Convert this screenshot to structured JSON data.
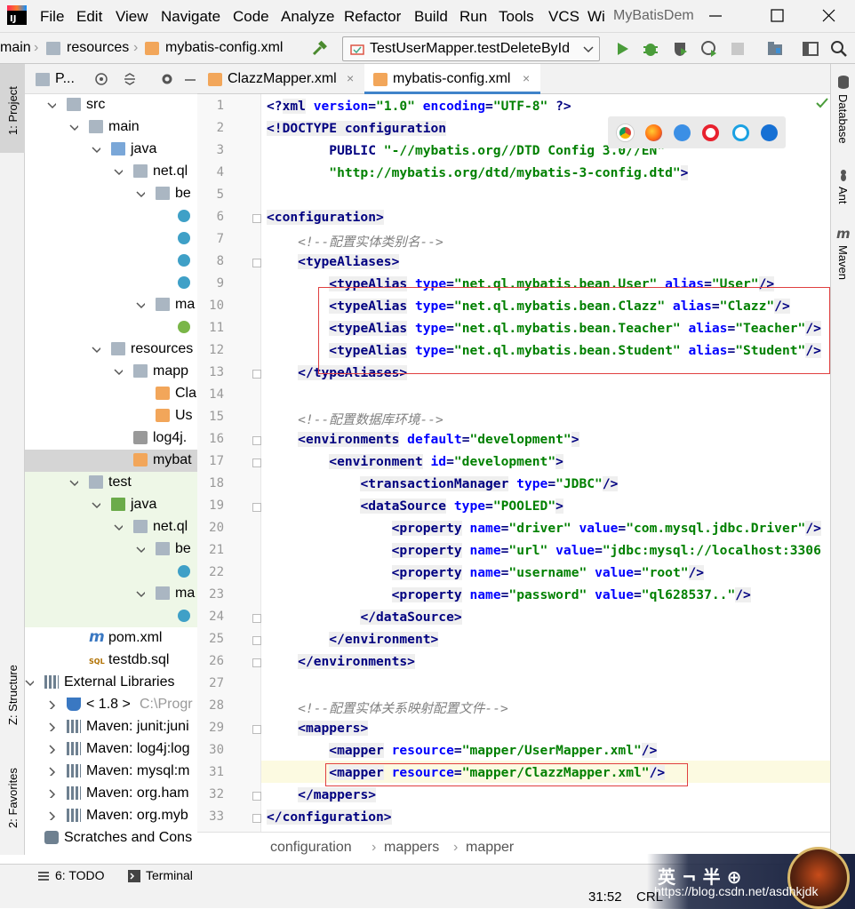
{
  "menu": {
    "items": [
      "File",
      "Edit",
      "View",
      "Navigate",
      "Code",
      "Analyze",
      "Refactor",
      "Build",
      "Run",
      "Tools",
      "VCS",
      "Wi"
    ],
    "project_title": "MyBatisDem"
  },
  "nav": {
    "crumbs": [
      "main",
      "resources",
      "mybatis-config.xml"
    ],
    "run_config": "TestUserMapper.testDeleteById"
  },
  "left_tools": {
    "project": "1: Project",
    "structure": "Z: Structure",
    "favorites": "2: Favorites"
  },
  "right_tools": {
    "database": "Database",
    "ant": "Ant",
    "maven": "Maven"
  },
  "project_panel": {
    "header_label": "P..."
  },
  "tree": [
    {
      "label": "src",
      "indent": 1,
      "icon": "folder",
      "arrow": "down"
    },
    {
      "label": "main",
      "indent": 2,
      "icon": "folder",
      "arrow": "down"
    },
    {
      "label": "java",
      "indent": 3,
      "icon": "folder-blue",
      "arrow": "down"
    },
    {
      "label": "net.ql",
      "indent": 4,
      "icon": "folder",
      "arrow": "down"
    },
    {
      "label": "be",
      "indent": 5,
      "icon": "folder",
      "arrow": "down"
    },
    {
      "label": "",
      "indent": 6,
      "icon": "class"
    },
    {
      "label": "",
      "indent": 6,
      "icon": "class"
    },
    {
      "label": "",
      "indent": 6,
      "icon": "class"
    },
    {
      "label": "",
      "indent": 6,
      "icon": "class"
    },
    {
      "label": "ma",
      "indent": 5,
      "icon": "folder",
      "arrow": "down"
    },
    {
      "label": "",
      "indent": 6,
      "icon": "interface"
    },
    {
      "label": "resources",
      "indent": 3,
      "icon": "folder",
      "arrow": "down"
    },
    {
      "label": "mapp",
      "indent": 4,
      "icon": "folder",
      "arrow": "down"
    },
    {
      "label": "Cla",
      "indent": 5,
      "icon": "xml"
    },
    {
      "label": "Us",
      "indent": 5,
      "icon": "xml"
    },
    {
      "label": "log4j.",
      "indent": 4,
      "icon": "props"
    },
    {
      "label": "mybat",
      "indent": 4,
      "icon": "xml",
      "selected": true
    },
    {
      "label": "test",
      "indent": 2,
      "icon": "folder",
      "arrow": "down"
    },
    {
      "label": "java",
      "indent": 3,
      "icon": "folder-green",
      "arrow": "down"
    },
    {
      "label": "net.ql",
      "indent": 4,
      "icon": "folder",
      "arrow": "down"
    },
    {
      "label": "be",
      "indent": 5,
      "icon": "folder",
      "arrow": "down"
    },
    {
      "label": "",
      "indent": 6,
      "icon": "class"
    },
    {
      "label": "ma",
      "indent": 5,
      "icon": "folder",
      "arrow": "down"
    },
    {
      "label": "",
      "indent": 6,
      "icon": "class"
    },
    {
      "label": "pom.xml",
      "indent": 2,
      "icon": "maven"
    },
    {
      "label": "testdb.sql",
      "indent": 2,
      "icon": "sql"
    },
    {
      "label": "External Libraries",
      "indent": 0,
      "icon": "lib",
      "arrow": "down"
    },
    {
      "label": "< 1.8 >",
      "indent": 1,
      "icon": "jdk",
      "arrow": "right",
      "suffix": "C:\\Progr"
    },
    {
      "label": "Maven: junit:juni",
      "indent": 1,
      "icon": "lib",
      "arrow": "right"
    },
    {
      "label": "Maven: log4j:log",
      "indent": 1,
      "icon": "lib",
      "arrow": "right"
    },
    {
      "label": "Maven: mysql:m",
      "indent": 1,
      "icon": "lib",
      "arrow": "right"
    },
    {
      "label": "Maven: org.ham",
      "indent": 1,
      "icon": "lib",
      "arrow": "right"
    },
    {
      "label": "Maven: org.myb",
      "indent": 1,
      "icon": "lib",
      "arrow": "right"
    },
    {
      "label": "Scratches and Cons",
      "indent": 0,
      "icon": "scratch"
    }
  ],
  "tabs": [
    {
      "label": "ClazzMapper.xml",
      "active": false
    },
    {
      "label": "mybatis-config.xml",
      "active": true
    }
  ],
  "code_lines": [
    [
      [
        "pl",
        "<?"
      ],
      [
        "tg",
        "xml"
      ],
      [
        "at",
        " version"
      ],
      [
        "pl",
        "="
      ],
      [
        "sv",
        "\"1.0\""
      ],
      [
        "at",
        " encoding"
      ],
      [
        "pl",
        "="
      ],
      [
        "sv",
        "\"UTF-8\""
      ],
      [
        "pl",
        " ?>"
      ]
    ],
    [
      [
        "tg",
        "<!DOCTYPE"
      ],
      [
        "tg",
        " configuration"
      ]
    ],
    [
      [
        "pl",
        "        PUBLIC "
      ],
      [
        "sv",
        "\"-//mybatis.org//DTD Config 3.0//EN\""
      ]
    ],
    [
      [
        "sv",
        "        \"http://mybatis.org/dtd/mybatis-3-config.dtd\""
      ],
      [
        "tg",
        ">"
      ]
    ],
    [],
    [
      [
        "tg",
        "<configuration>"
      ]
    ],
    [
      [
        "cm",
        "    <!--配置实体类别名-->"
      ]
    ],
    [
      [
        "pl",
        "    "
      ],
      [
        "tg",
        "<typeAliases>"
      ]
    ],
    [
      [
        "pl",
        "        "
      ],
      [
        "tg",
        "<typeAlias"
      ],
      [
        "at",
        " type"
      ],
      [
        "pl",
        "="
      ],
      [
        "sv",
        "\"net.ql.mybatis.bean.User\""
      ],
      [
        "at",
        " alias"
      ],
      [
        "pl",
        "="
      ],
      [
        "sv",
        "\"User\""
      ],
      [
        "tg",
        "/>"
      ]
    ],
    [
      [
        "pl",
        "        "
      ],
      [
        "tg",
        "<typeAlias"
      ],
      [
        "at",
        " type"
      ],
      [
        "pl",
        "="
      ],
      [
        "sv",
        "\"net.ql.mybatis.bean.Clazz\""
      ],
      [
        "at",
        " alias"
      ],
      [
        "pl",
        "="
      ],
      [
        "sv",
        "\"Clazz\""
      ],
      [
        "tg",
        "/>"
      ]
    ],
    [
      [
        "pl",
        "        "
      ],
      [
        "tg",
        "<typeAlias"
      ],
      [
        "at",
        " type"
      ],
      [
        "pl",
        "="
      ],
      [
        "sv",
        "\"net.ql.mybatis.bean.Teacher\""
      ],
      [
        "at",
        " alias"
      ],
      [
        "pl",
        "="
      ],
      [
        "sv",
        "\"Teacher\""
      ],
      [
        "tg",
        "/>"
      ]
    ],
    [
      [
        "pl",
        "        "
      ],
      [
        "tg",
        "<typeAlias"
      ],
      [
        "at",
        " type"
      ],
      [
        "pl",
        "="
      ],
      [
        "sv",
        "\"net.ql.mybatis.bean.Student\""
      ],
      [
        "at",
        " alias"
      ],
      [
        "pl",
        "="
      ],
      [
        "sv",
        "\"Student\""
      ],
      [
        "tg",
        "/>"
      ]
    ],
    [
      [
        "pl",
        "    "
      ],
      [
        "tg",
        "</typeAliases>"
      ]
    ],
    [],
    [
      [
        "cm",
        "    <!--配置数据库环境-->"
      ]
    ],
    [
      [
        "pl",
        "    "
      ],
      [
        "tg",
        "<environments"
      ],
      [
        "at",
        " default"
      ],
      [
        "pl",
        "="
      ],
      [
        "sv",
        "\"development\""
      ],
      [
        "tg",
        ">"
      ]
    ],
    [
      [
        "pl",
        "        "
      ],
      [
        "tg",
        "<environment"
      ],
      [
        "at",
        " id"
      ],
      [
        "pl",
        "="
      ],
      [
        "sv",
        "\"development\""
      ],
      [
        "tg",
        ">"
      ]
    ],
    [
      [
        "pl",
        "            "
      ],
      [
        "tg",
        "<transactionManager"
      ],
      [
        "at",
        " type"
      ],
      [
        "pl",
        "="
      ],
      [
        "sv",
        "\"JDBC\""
      ],
      [
        "tg",
        "/>"
      ]
    ],
    [
      [
        "pl",
        "            "
      ],
      [
        "tg",
        "<dataSource"
      ],
      [
        "at",
        " type"
      ],
      [
        "pl",
        "="
      ],
      [
        "sv",
        "\"POOLED\""
      ],
      [
        "tg",
        ">"
      ]
    ],
    [
      [
        "pl",
        "                "
      ],
      [
        "tg",
        "<property"
      ],
      [
        "at",
        " name"
      ],
      [
        "pl",
        "="
      ],
      [
        "sv",
        "\"driver\""
      ],
      [
        "at",
        " value"
      ],
      [
        "pl",
        "="
      ],
      [
        "sv",
        "\"com.mysql.jdbc.Driver\""
      ],
      [
        "tg",
        "/>"
      ]
    ],
    [
      [
        "pl",
        "                "
      ],
      [
        "tg",
        "<property"
      ],
      [
        "at",
        " name"
      ],
      [
        "pl",
        "="
      ],
      [
        "sv",
        "\"url\""
      ],
      [
        "at",
        " value"
      ],
      [
        "pl",
        "="
      ],
      [
        "sv",
        "\"jdbc:mysql://localhost:3306"
      ]
    ],
    [
      [
        "pl",
        "                "
      ],
      [
        "tg",
        "<property"
      ],
      [
        "at",
        " name"
      ],
      [
        "pl",
        "="
      ],
      [
        "sv",
        "\"username\""
      ],
      [
        "at",
        " value"
      ],
      [
        "pl",
        "="
      ],
      [
        "sv",
        "\"root\""
      ],
      [
        "tg",
        "/>"
      ]
    ],
    [
      [
        "pl",
        "                "
      ],
      [
        "tg",
        "<property"
      ],
      [
        "at",
        " name"
      ],
      [
        "pl",
        "="
      ],
      [
        "sv",
        "\"password\""
      ],
      [
        "at",
        " value"
      ],
      [
        "pl",
        "="
      ],
      [
        "sv",
        "\"ql628537..\""
      ],
      [
        "tg",
        "/>"
      ]
    ],
    [
      [
        "pl",
        "            "
      ],
      [
        "tg",
        "</dataSource>"
      ]
    ],
    [
      [
        "pl",
        "        "
      ],
      [
        "tg",
        "</environment>"
      ]
    ],
    [
      [
        "pl",
        "    "
      ],
      [
        "tg",
        "</environments>"
      ]
    ],
    [],
    [
      [
        "cm",
        "    <!--配置实体关系映射配置文件-->"
      ]
    ],
    [
      [
        "pl",
        "    "
      ],
      [
        "tg",
        "<mappers>"
      ]
    ],
    [
      [
        "pl",
        "        "
      ],
      [
        "tg",
        "<mapper"
      ],
      [
        "at",
        " resource"
      ],
      [
        "pl",
        "="
      ],
      [
        "sv",
        "\"mapper/UserMapper.xml\""
      ],
      [
        "tg",
        "/>"
      ]
    ],
    [
      [
        "pl",
        "        "
      ],
      [
        "tg",
        "<mapper"
      ],
      [
        "at",
        " resource"
      ],
      [
        "pl",
        "="
      ],
      [
        "sv",
        "\"mapper/ClazzMapper.xml\""
      ],
      [
        "tg",
        "/>"
      ]
    ],
    [
      [
        "pl",
        "    "
      ],
      [
        "tg",
        "</mappers>"
      ]
    ],
    [
      [
        "tg",
        "</configuration>"
      ]
    ]
  ],
  "breadcrumbs": [
    "configuration",
    "mappers",
    "mapper"
  ],
  "status": {
    "todo": "6: TODO",
    "terminal": "Terminal",
    "position": "31:52",
    "line_sep": "CRL",
    "watermark": "https://blog.csdn.net/asdhkjdk"
  },
  "colors": {
    "tag": "#000080",
    "attr": "#0000ff",
    "string": "#008000",
    "comment": "#808080",
    "current_line": "#fcfae1",
    "annotation_box": "#e04040"
  }
}
